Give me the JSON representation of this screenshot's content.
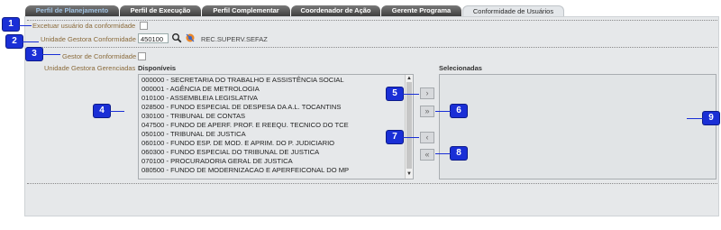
{
  "tabs": [
    {
      "label": "Perfil de Planejamento"
    },
    {
      "label": "Perfil de Execução"
    },
    {
      "label": "Perfil Complementar"
    },
    {
      "label": "Coordenador de Ação"
    },
    {
      "label": "Gerente Programa"
    },
    {
      "label": "Conformidade de Usuários"
    }
  ],
  "active_tab": "Conformidade de Usuários",
  "form": {
    "excetuar_label": "Excetuar usuário da conformidade",
    "unidade_gestora_label": "Unidade Gestora Conformidade",
    "unidade_gestora_value": "450100",
    "unidade_gestora_name": "REC.SUPERV.SEFAZ",
    "gestor_label": "Gestor de Conformidade",
    "gerenciadas_label": "Unidade Gestora Gerenciadas",
    "disponiveis_label": "Disponíveis",
    "selecionadas_label": "Selecionadas"
  },
  "available_items": [
    "000000 - SECRETARIA DO TRABALHO E ASSISTÊNCIA SOCIAL",
    "000001 - AGÊNCIA DE METROLOGIA",
    "010100 - ASSEMBLEIA LEGISLATIVA",
    "028500 - FUNDO ESPECIAL DE DESPESA DA A.L. TOCANTINS",
    "030100 - TRIBUNAL DE CONTAS",
    "047500 - FUNDO DE APERF. PROF. E REEQU. TECNICO DO TCE",
    "050100 - TRIBUNAL DE JUSTICA",
    "060100 - FUNDO ESP. DE MOD. E APRIM. DO P. JUDICIARIO",
    "060300 - FUNDO ESPECIAL DO TRIBUNAL DE JUSTICA",
    "070100 - PROCURADORIA GERAL DE JUSTICA",
    "080500 - FUNDO DE MODERNIZACAO E APERFEICONAL DO MP"
  ],
  "buttons": {
    "move_one_right": "›",
    "move_all_right": "»",
    "move_one_left": "‹",
    "move_all_left": "«"
  },
  "badges": [
    "1",
    "2",
    "3",
    "4",
    "5",
    "6",
    "7",
    "8",
    "9"
  ],
  "colors": {
    "badge": "#1a2fd6",
    "active_tab_text": "#2a2a2a",
    "label_brown": "#8a6a3a"
  },
  "icons": [
    "search-icon",
    "clear-filter-icon"
  ]
}
